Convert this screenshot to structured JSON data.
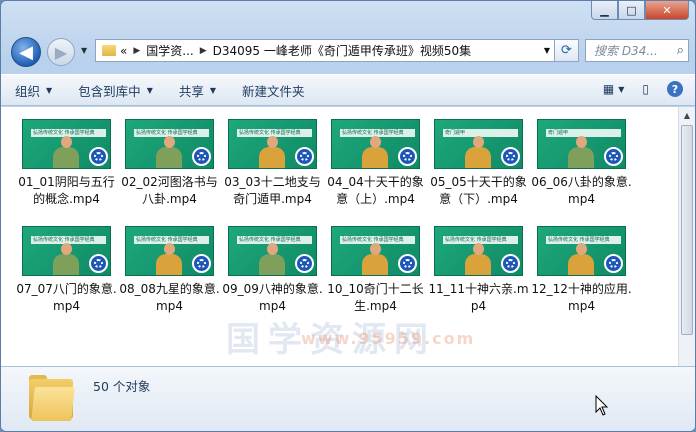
{
  "window": {
    "caption_buttons": {
      "minimize": "▁",
      "maximize": "□",
      "close": "✕"
    }
  },
  "nav": {
    "back_glyph": "◀",
    "forward_glyph": "▶",
    "dropdown_glyph": "▼",
    "breadcrumb": [
      "«",
      "国学资...",
      "D34095 一峰老师《奇门遁甲传承班》视频50集"
    ],
    "search_placeholder": "搜索 D34...",
    "refresh_glyph": "⟳"
  },
  "toolbar": {
    "organize": "组织",
    "include_library": "包含到库中",
    "share": "共享",
    "new_folder": "新建文件夹",
    "view_glyph": "▦",
    "pane_glyph": "▯",
    "help_glyph": "?"
  },
  "files": [
    {
      "name": "01_01阴阳与五行的概念.mp4",
      "banner": "弘扬传统文化 传承国学经典",
      "shirt": "#7fa05a"
    },
    {
      "name": "02_02河图洛书与八卦.mp4",
      "banner": "弘扬传统文化 传承国学经典",
      "shirt": "#7fa05a"
    },
    {
      "name": "03_03十二地支与奇门遁甲.mp4",
      "banner": "弘扬传统文化 传承国学经典",
      "shirt": "#d9a23a"
    },
    {
      "name": "04_04十天干的象意（上）.mp4",
      "banner": "弘扬传统文化 传承国学经典",
      "shirt": "#d9a23a"
    },
    {
      "name": "05_05十天干的象意（下）.mp4",
      "banner": "奇门遁甲",
      "shirt": "#d9a23a"
    },
    {
      "name": "06_06八卦的象意.mp4",
      "banner": "奇门遁甲",
      "shirt": "#7fa05a"
    },
    {
      "name": "07_07八门的象意.mp4",
      "banner": "弘扬传统文化 传承国学经典",
      "shirt": "#7fa05a"
    },
    {
      "name": "08_08九星的象意.mp4",
      "banner": "弘扬传统文化 传承国学经典",
      "shirt": "#d9a23a"
    },
    {
      "name": "09_09八神的象意.mp4",
      "banner": "弘扬传统文化 传承国学经典",
      "shirt": "#7fa05a"
    },
    {
      "name": "10_10奇门十二长生.mp4",
      "banner": "弘扬传统文化 传承国学经典",
      "shirt": "#d9a23a"
    },
    {
      "name": "11_11十神六亲.mp4",
      "banner": "弘扬传统文化 传承国学经典",
      "shirt": "#d9a23a"
    },
    {
      "name": "12_12十神的应用.mp4",
      "banner": "弘扬传统文化 传承国学经典",
      "shirt": "#d9a23a"
    }
  ],
  "watermark": {
    "main": "国学资源网",
    "sub": "www.95959.com"
  },
  "status": {
    "count": "50 个对象"
  }
}
